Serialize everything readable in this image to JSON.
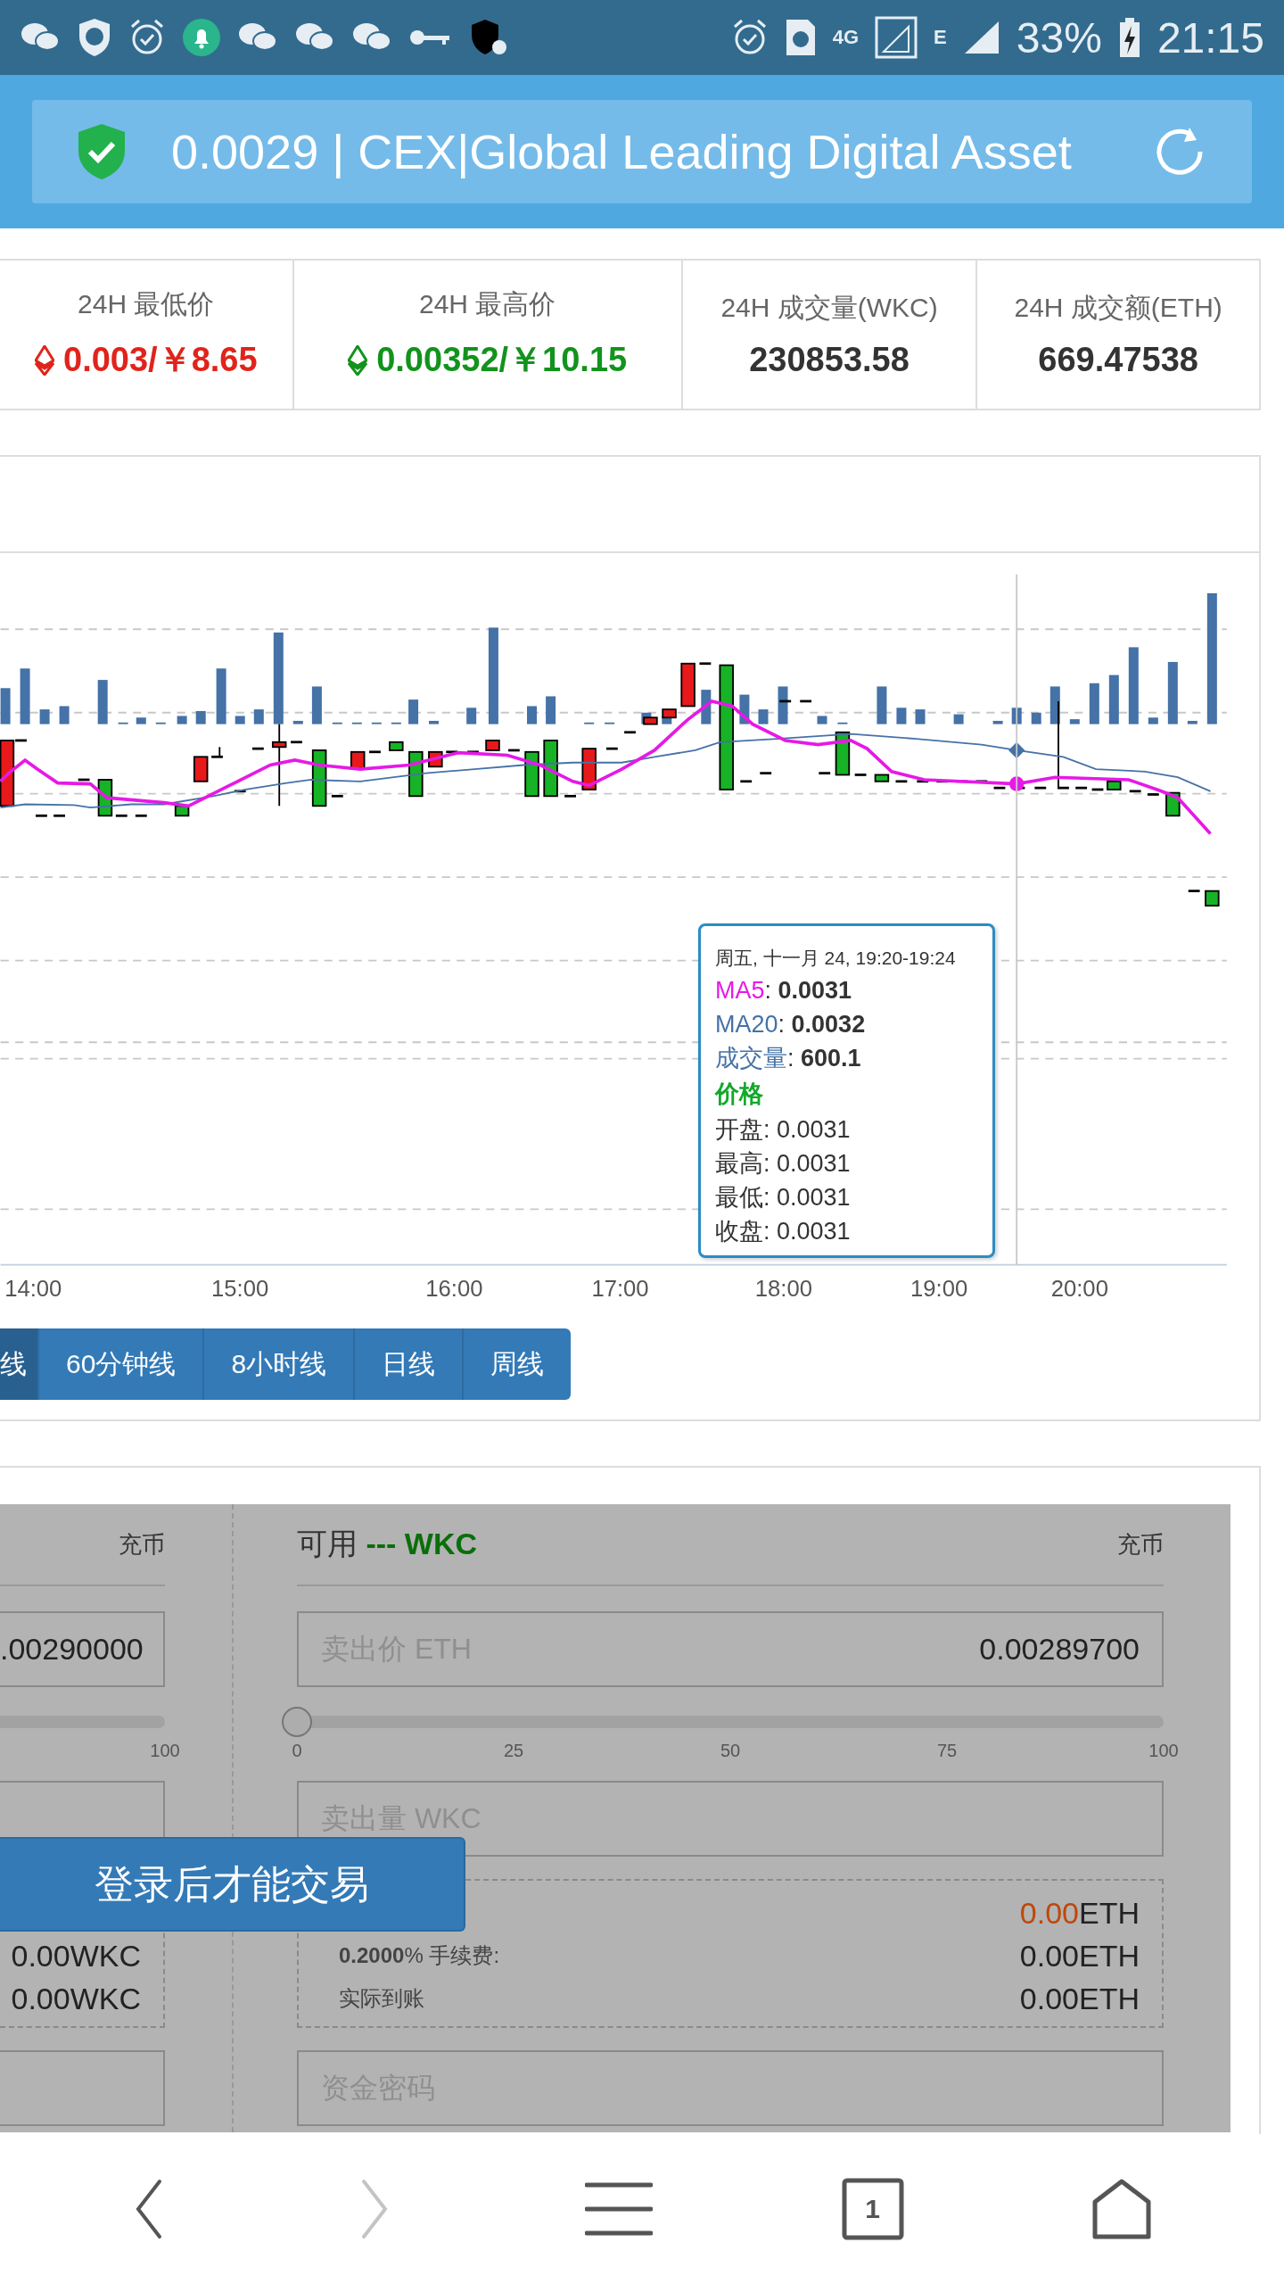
{
  "status_bar": {
    "network": "4G",
    "network_2": "E",
    "battery": "33%",
    "time": "21:15"
  },
  "header": {
    "title": "0.0029 | CEX|Global Leading Digital Asset"
  },
  "stats": [
    {
      "label": "24H 最低价",
      "value": "0.003/￥8.65",
      "kind": "low"
    },
    {
      "label": "24H 最高价",
      "value": "0.00352/￥10.15",
      "kind": "high"
    },
    {
      "label": "24H 成交量(WKC)",
      "value": "230853.58",
      "kind": "plain"
    },
    {
      "label": "24H 成交额(ETH)",
      "value": "669.47538",
      "kind": "plain"
    }
  ],
  "chart": {
    "x_axis_labels": [
      "14:00",
      "15:00",
      "16:00",
      "17:00",
      "18:00",
      "19:00",
      "20:00"
    ],
    "tooltip": {
      "date": "周五, 十一月 24, 19:20-19:24",
      "series": [
        {
          "label": "MA5",
          "value": ": **0.0031**",
          "color": "#e619e6"
        },
        {
          "label": "MA20",
          "value": ": **0.0032**",
          "color": "#4572a7"
        },
        {
          "label": "成交量",
          "value": ": **600.1**",
          "color": "#4572a7"
        }
      ],
      "price_heading": "价格",
      "price_rows": [
        "开盘: 0.0031",
        "最高: 0.0031",
        "最低: 0.0031",
        "收盘: 0.0031"
      ]
    }
  },
  "periods": [
    {
      "label": "线",
      "selected": true
    },
    {
      "label": "60分钟线",
      "selected": false
    },
    {
      "label": "8小时线",
      "selected": false
    },
    {
      "label": "日线",
      "selected": false
    },
    {
      "label": "周线",
      "selected": false
    }
  ],
  "trade": {
    "left": {
      "action": "充币",
      "price_value": ".00290000",
      "slider_ticks": [
        "100"
      ],
      "summary": [
        {
          "amount": "0.00",
          "unit": "WKC",
          "highlight": false
        },
        {
          "amount": "0.00",
          "unit": "WKC",
          "highlight": false
        }
      ]
    },
    "right": {
      "available_label": "可用",
      "available_value": "--- WKC",
      "action": "充币",
      "price_label": "卖出价 ETH",
      "price_value": "0.00289700",
      "slider": {
        "level": 0,
        "ticks": [
          "0",
          "25",
          "50",
          "75",
          "100"
        ]
      },
      "amount_placeholder": "卖出量 WKC",
      "summary": [
        {
          "amount": "0.00",
          "unit": "ETH",
          "highlight": true
        },
        {
          "label": "**0.2000**% 手续费:",
          "amount": "0.00",
          "unit": "ETH",
          "highlight": false
        },
        {
          "label": "实际到账",
          "amount": "0.00",
          "unit": "ETH",
          "highlight": false
        }
      ],
      "password_placeholder": "资金密码"
    },
    "login_button": "登录后才能交易"
  },
  "nav": {
    "items": [
      {
        "kind": "back",
        "disabled": false
      },
      {
        "kind": "forward",
        "disabled": true
      },
      {
        "kind": "menu",
        "disabled": false
      },
      {
        "kind": "tabs",
        "label": "1",
        "disabled": false
      },
      {
        "kind": "home",
        "disabled": false
      }
    ]
  }
}
